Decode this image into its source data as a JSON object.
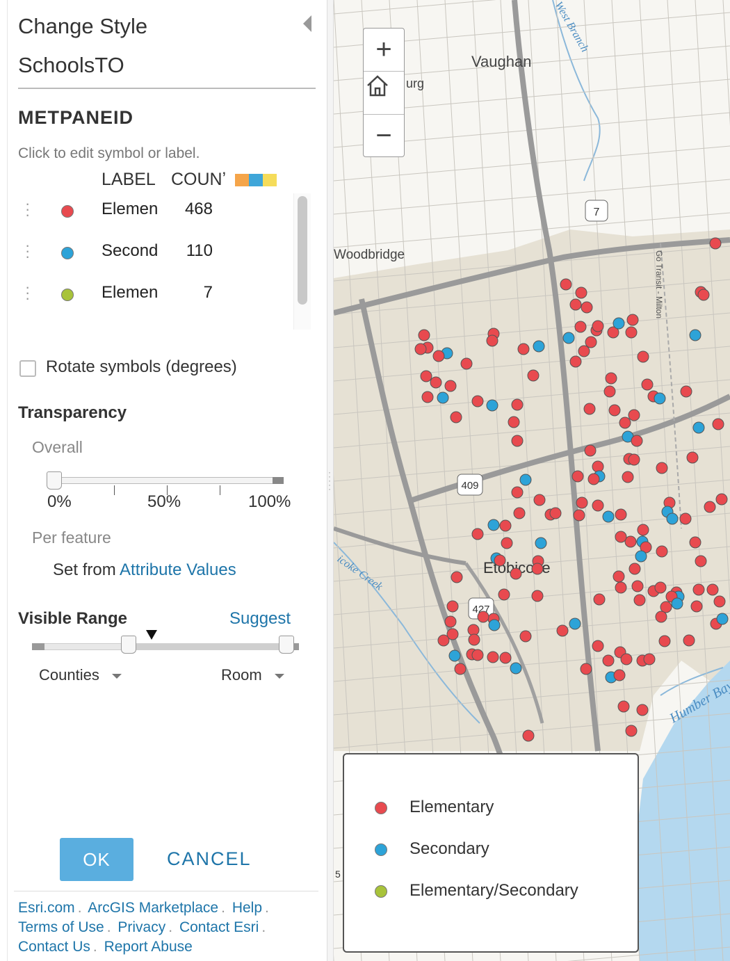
{
  "panel": {
    "title": "Change Style",
    "layer": "SchoolsTO",
    "field": "METPANEID",
    "hint": "Click to edit symbol or label.",
    "headers": {
      "label": "LABEL",
      "count": "COUNʼ"
    },
    "ramp_colors": [
      "#f5a54a",
      "#3fa6d9",
      "#f5dc5a"
    ],
    "rows": [
      {
        "label": "Elemen",
        "count": "468",
        "color": "#e84a4f"
      },
      {
        "label": "Second",
        "count": "110",
        "color": "#2da3d8"
      },
      {
        "label": "Elemen",
        "count": "7",
        "color": "#a8c33a"
      }
    ],
    "rotate_label": "Rotate symbols (degrees)",
    "transparency": {
      "title": "Transparency",
      "overall": "Overall",
      "value_percent": 0,
      "ticks": [
        "0%",
        "50%",
        "100%"
      ],
      "per_feature": "Per feature",
      "set_from": "Set from",
      "attribute_values": "Attribute Values"
    },
    "visible_range": {
      "title": "Visible Range",
      "suggest": "Suggest",
      "min": "Counties",
      "max": "Room"
    },
    "ok": "OK",
    "cancel": "CANCEL"
  },
  "footer": {
    "line1": [
      "Esri.com",
      "ArcGIS Marketplace",
      "Help"
    ],
    "line2": [
      "Terms of Use",
      "Privacy",
      "Contact Esri"
    ],
    "line3": [
      "Contact Us",
      "Report Abuse"
    ]
  },
  "map": {
    "place_labels": [
      "Vaughan",
      "Woodbridge",
      "Etobicoke",
      "Humber Bay",
      "urg",
      "Go Transit - Milton",
      "West Branch",
      "icoke Creek"
    ],
    "highway_shields": [
      "7",
      "409",
      "427",
      "5"
    ],
    "zoom_in": "+",
    "zoom_out": "−",
    "legend": [
      {
        "label": "Elementary",
        "color": "#e84a4f"
      },
      {
        "label": "Secondary",
        "color": "#2da3d8"
      },
      {
        "label": "Elementary/Secondary",
        "color": "#a8c33a"
      }
    ]
  }
}
